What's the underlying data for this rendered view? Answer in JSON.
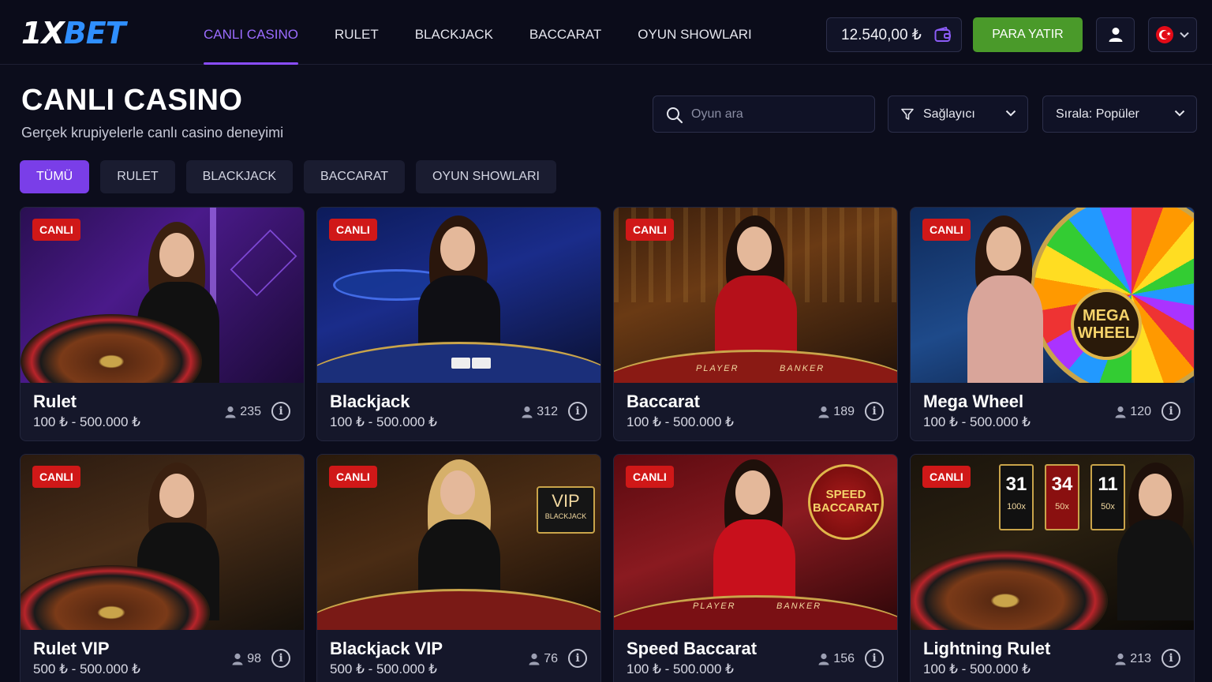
{
  "brand": {
    "logo_part1": "1X",
    "logo_part2": "BET"
  },
  "nav": [
    {
      "label": "CANLI CASINO",
      "active": true
    },
    {
      "label": "RULET",
      "active": false
    },
    {
      "label": "BLACKJACK",
      "active": false
    },
    {
      "label": "BACCARAT",
      "active": false
    },
    {
      "label": "OYUN SHOWLARI",
      "active": false
    }
  ],
  "header": {
    "balance": "12.540,00 ₺",
    "deposit_label": "PARA YATIR",
    "icons": [
      "wallet-icon",
      "user-icon",
      "turkey-flag-icon",
      "chevron-down-icon"
    ]
  },
  "page": {
    "title": "CANLI CASINO",
    "subtitle": "Gerçek krupiyelerle canlı casino deneyimi"
  },
  "search": {
    "placeholder": "Oyun ara"
  },
  "filters": {
    "provider_label": "Sağlayıcı",
    "sort_label": "Sırala: Popüler"
  },
  "chips": [
    {
      "label": "TÜMÜ",
      "active": true
    },
    {
      "label": "RULET",
      "active": false
    },
    {
      "label": "BLACKJACK",
      "active": false
    },
    {
      "label": "BACCARAT",
      "active": false
    },
    {
      "label": "OYUN SHOWLARI",
      "active": false
    }
  ],
  "games": [
    {
      "badge": "CANLI",
      "title": "Rulet",
      "range": "100 ₺ - 500.000 ₺",
      "players": "235"
    },
    {
      "badge": "CANLI",
      "title": "Blackjack",
      "range": "100 ₺ - 500.000 ₺",
      "players": "312"
    },
    {
      "badge": "CANLI",
      "title": "Baccarat",
      "range": "100 ₺ - 500.000 ₺",
      "players": "189",
      "scene_text": [
        "PLAYER",
        "BANKER"
      ]
    },
    {
      "badge": "CANLI",
      "title": "Mega Wheel",
      "range": "100 ₺ - 500.000 ₺",
      "players": "120",
      "scene_text": [
        "MEGA",
        "WHEEL"
      ]
    },
    {
      "badge": "CANLI",
      "title": "Rulet VIP",
      "range": "500 ₺ - 500.000 ₺",
      "players": "98"
    },
    {
      "badge": "CANLI",
      "title": "Blackjack VIP",
      "range": "500 ₺ - 500.000 ₺",
      "players": "76",
      "scene_text": [
        "VIP",
        "BLACKJACK"
      ]
    },
    {
      "badge": "CANLI",
      "title": "Speed Baccarat",
      "range": "100 ₺ - 500.000 ₺",
      "players": "156",
      "scene_text": [
        "SPEED",
        "BACCARAT",
        "PLAYER",
        "BANKER"
      ]
    },
    {
      "badge": "CANLI",
      "title": "Lightning Rulet",
      "range": "100 ₺ - 500.000 ₺",
      "players": "213",
      "scene_text": [
        "31",
        "100x",
        "34",
        "50x",
        "11",
        "50x"
      ]
    }
  ],
  "colors": {
    "accent": "#8a4dff",
    "deposit": "#4a9a2a",
    "live_badge": "#d01818",
    "background": "#0c0d1c"
  }
}
